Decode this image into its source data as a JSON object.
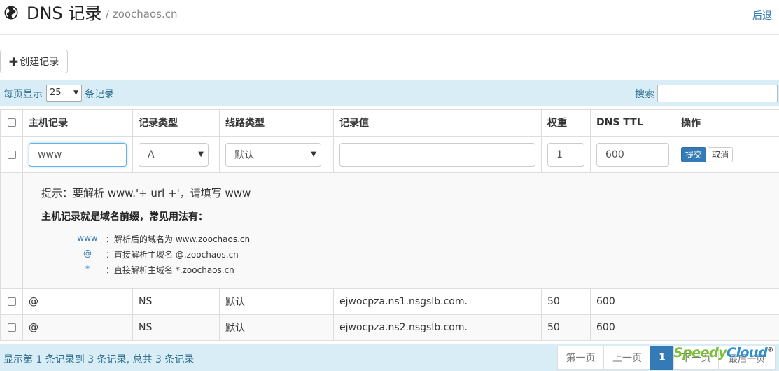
{
  "header": {
    "title": "DNS 记录",
    "subtitle": "/ zoochaos.cn",
    "back_label": "后退"
  },
  "create_button_label": "创建记录",
  "toolbar": {
    "perpage_prefix": "每页显示",
    "perpage_value": "25",
    "perpage_suffix": "条记录",
    "search_label": "搜索",
    "search_value": ""
  },
  "table": {
    "columns": [
      "主机记录",
      "记录类型",
      "线路类型",
      "记录值",
      "权重",
      "DNS TTL",
      "操作"
    ],
    "edit_row": {
      "host": "www",
      "type": "A",
      "line": "默认",
      "value": "",
      "weight": "1",
      "ttl": "600",
      "submit_label": "提交",
      "cancel_label": "取消"
    },
    "help": {
      "hint": "提示：要解析 www.'+ url +'，请填写 www",
      "heading": "主机记录就是域名前缀，常见用法有：",
      "examples": [
        {
          "key": "www",
          "desc": "：解析后的域名为 www.zoochaos.cn"
        },
        {
          "key": "@",
          "desc": "：直接解析主域名 @.zoochaos.cn"
        },
        {
          "key": "*",
          "desc": "：直接解析主域名 *.zoochaos.cn"
        }
      ]
    },
    "rows": [
      {
        "host": "@",
        "type": "NS",
        "line": "默认",
        "value": "ejwocpza.ns1.nsgslb.com.",
        "weight": "50",
        "ttl": "600"
      },
      {
        "host": "@",
        "type": "NS",
        "line": "默认",
        "value": "ejwocpza.ns2.nsgslb.com.",
        "weight": "50",
        "ttl": "600"
      }
    ]
  },
  "footer": {
    "info": "显示第 1 条记录到 3 条记录, 总共 3 条记录",
    "pager": {
      "first": "第一页",
      "prev": "上一页",
      "current": "1",
      "next_partial": "下一页",
      "last_partial": "最后一页"
    }
  },
  "watermark": {
    "part1": "Speedy",
    "part2": "Cloud",
    "mark": "®"
  },
  "colors": {
    "accent": "#337ab7",
    "toolbar_bg": "#d9edf7",
    "toolbar_text": "#31708f"
  }
}
